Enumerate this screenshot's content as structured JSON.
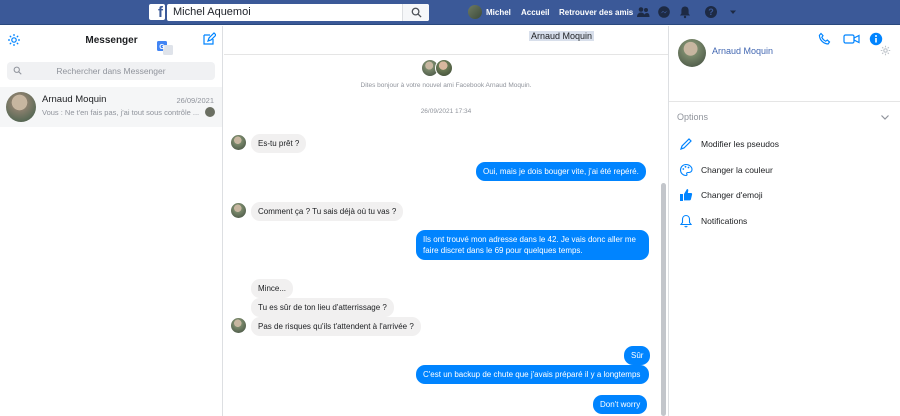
{
  "topbar": {
    "logo": "f",
    "search_value": "Michel Aquemoi",
    "user_name": "Michel",
    "links": [
      "Accueil",
      "Retrouver des amis"
    ],
    "colors": {
      "bar": "#3b5998"
    }
  },
  "sidebar": {
    "title": "Messenger",
    "search_placeholder": "Rechercher dans Messenger",
    "conversations": [
      {
        "name": "Arnaud Moquin",
        "date": "26/09/2021",
        "preview": "Vous : Ne t'en fais pas, j'ai tout sous contrôle ..."
      }
    ]
  },
  "chat": {
    "title": "Arnaud Moquin",
    "intro": "Dites bonjour à votre nouvel ami Facebook Arnaud Moquin.",
    "timestamp": "26/09/2021 17:34",
    "messages": [
      {
        "dir": "in",
        "text": "Es-tu prêt ?"
      },
      {
        "dir": "out",
        "text": "Oui, mais je dois bouger vite, j'ai été repéré."
      },
      {
        "dir": "in",
        "text": "Comment ça ? Tu sais déjà où tu vas ?"
      },
      {
        "dir": "out",
        "text": "Ils ont trouvé mon adresse dans le 42. Je vais donc aller me faire discret dans le 69 pour quelques temps."
      },
      {
        "dir": "in",
        "text": "Mince..."
      },
      {
        "dir": "in",
        "text": "Tu es sûr de ton lieu d'atterrissage ?"
      },
      {
        "dir": "in",
        "text": "Pas de risques qu'ils t'attendent à l'arrivée ?"
      },
      {
        "dir": "out",
        "text": "Sûr"
      },
      {
        "dir": "out",
        "text": "C'est un backup de chute que j'avais préparé il y a longtemps"
      },
      {
        "dir": "out",
        "text": "Don't worry"
      }
    ],
    "colors": {
      "out_bubble": "#0084ff",
      "in_bubble": "#f1f0f0",
      "accent": "#0084ff"
    }
  },
  "details": {
    "name": "Arnaud Moquin",
    "options_label": "Options",
    "options": [
      "Modifier les pseudos",
      "Changer la couleur",
      "Changer d'emoji",
      "Notifications"
    ]
  }
}
